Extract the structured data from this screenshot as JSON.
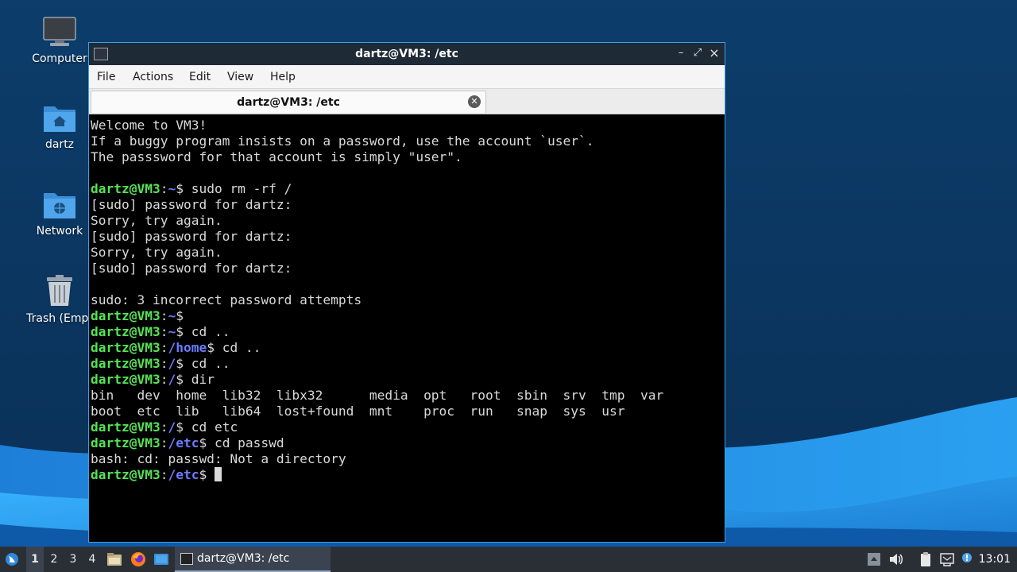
{
  "desktop": {
    "icons": [
      {
        "label": "Computer"
      },
      {
        "label": "dartz"
      },
      {
        "label": "Network"
      },
      {
        "label": "Trash (Empt"
      }
    ]
  },
  "window": {
    "title": "dartz@VM3: /etc",
    "menu": [
      "File",
      "Actions",
      "Edit",
      "View",
      "Help"
    ],
    "tab_label": "dartz@VM3: /etc",
    "close_symbol": "×",
    "minimize_symbol": "–",
    "maximize_symbol": "⤢",
    "tab_close_symbol": "✕"
  },
  "terminal": {
    "lines": [
      [
        {
          "t": "Welcome to VM3!",
          "c": "white"
        }
      ],
      [
        {
          "t": "If a buggy program insists on a password, use the account `user`.",
          "c": "white"
        }
      ],
      [
        {
          "t": "The passsword for that account is simply \"user\".",
          "c": "white"
        }
      ],
      [
        {
          "t": "",
          "c": "white"
        }
      ],
      [
        {
          "t": "dartz@VM3",
          "c": "user"
        },
        {
          "t": ":",
          "c": "white"
        },
        {
          "t": "~",
          "c": "path"
        },
        {
          "t": "$ sudo rm -rf /",
          "c": "white"
        }
      ],
      [
        {
          "t": "[sudo] password for dartz:",
          "c": "white"
        }
      ],
      [
        {
          "t": "Sorry, try again.",
          "c": "white"
        }
      ],
      [
        {
          "t": "[sudo] password for dartz:",
          "c": "white"
        }
      ],
      [
        {
          "t": "Sorry, try again.",
          "c": "white"
        }
      ],
      [
        {
          "t": "[sudo] password for dartz:",
          "c": "white"
        }
      ],
      [
        {
          "t": "",
          "c": "white"
        }
      ],
      [
        {
          "t": "sudo: 3 incorrect password attempts",
          "c": "white"
        }
      ],
      [
        {
          "t": "dartz@VM3",
          "c": "user"
        },
        {
          "t": ":",
          "c": "white"
        },
        {
          "t": "~",
          "c": "path"
        },
        {
          "t": "$",
          "c": "white"
        }
      ],
      [
        {
          "t": "dartz@VM3",
          "c": "user"
        },
        {
          "t": ":",
          "c": "white"
        },
        {
          "t": "~",
          "c": "path"
        },
        {
          "t": "$ cd ..",
          "c": "white"
        }
      ],
      [
        {
          "t": "dartz@VM3",
          "c": "user"
        },
        {
          "t": ":",
          "c": "white"
        },
        {
          "t": "/home",
          "c": "path"
        },
        {
          "t": "$ cd ..",
          "c": "white"
        }
      ],
      [
        {
          "t": "dartz@VM3",
          "c": "user"
        },
        {
          "t": ":",
          "c": "white"
        },
        {
          "t": "/",
          "c": "path"
        },
        {
          "t": "$ cd ..",
          "c": "white"
        }
      ],
      [
        {
          "t": "dartz@VM3",
          "c": "user"
        },
        {
          "t": ":",
          "c": "white"
        },
        {
          "t": "/",
          "c": "path"
        },
        {
          "t": "$ dir",
          "c": "white"
        }
      ],
      [
        {
          "t": "bin   dev  home  lib32  libx32      media  opt   root  sbin  srv  tmp  var",
          "c": "white"
        }
      ],
      [
        {
          "t": "boot  etc  lib   lib64  lost+found  mnt    proc  run   snap  sys  usr",
          "c": "white"
        }
      ],
      [
        {
          "t": "dartz@VM3",
          "c": "user"
        },
        {
          "t": ":",
          "c": "white"
        },
        {
          "t": "/",
          "c": "path"
        },
        {
          "t": "$ cd etc",
          "c": "white"
        }
      ],
      [
        {
          "t": "dartz@VM3",
          "c": "user"
        },
        {
          "t": ":",
          "c": "white"
        },
        {
          "t": "/etc",
          "c": "path"
        },
        {
          "t": "$ cd passwd",
          "c": "white"
        }
      ],
      [
        {
          "t": "bash: cd: passwd: Not a directory",
          "c": "white"
        }
      ],
      [
        {
          "t": "dartz@VM3",
          "c": "user"
        },
        {
          "t": ":",
          "c": "white"
        },
        {
          "t": "/etc",
          "c": "path"
        },
        {
          "t": "$ ",
          "c": "white"
        },
        {
          "cursor": true
        }
      ]
    ]
  },
  "taskbar": {
    "workspaces": [
      "1",
      "2",
      "3",
      "4"
    ],
    "active_workspace": "1",
    "task_label": "dartz@VM3: /etc",
    "clock": "13:01"
  },
  "colors": {
    "prompt_user": "#55e355",
    "prompt_path": "#6b7cff",
    "terminal_bg": "#000000",
    "window_border": "#3aa0e8",
    "taskbar_bg": "#2a2f36"
  }
}
